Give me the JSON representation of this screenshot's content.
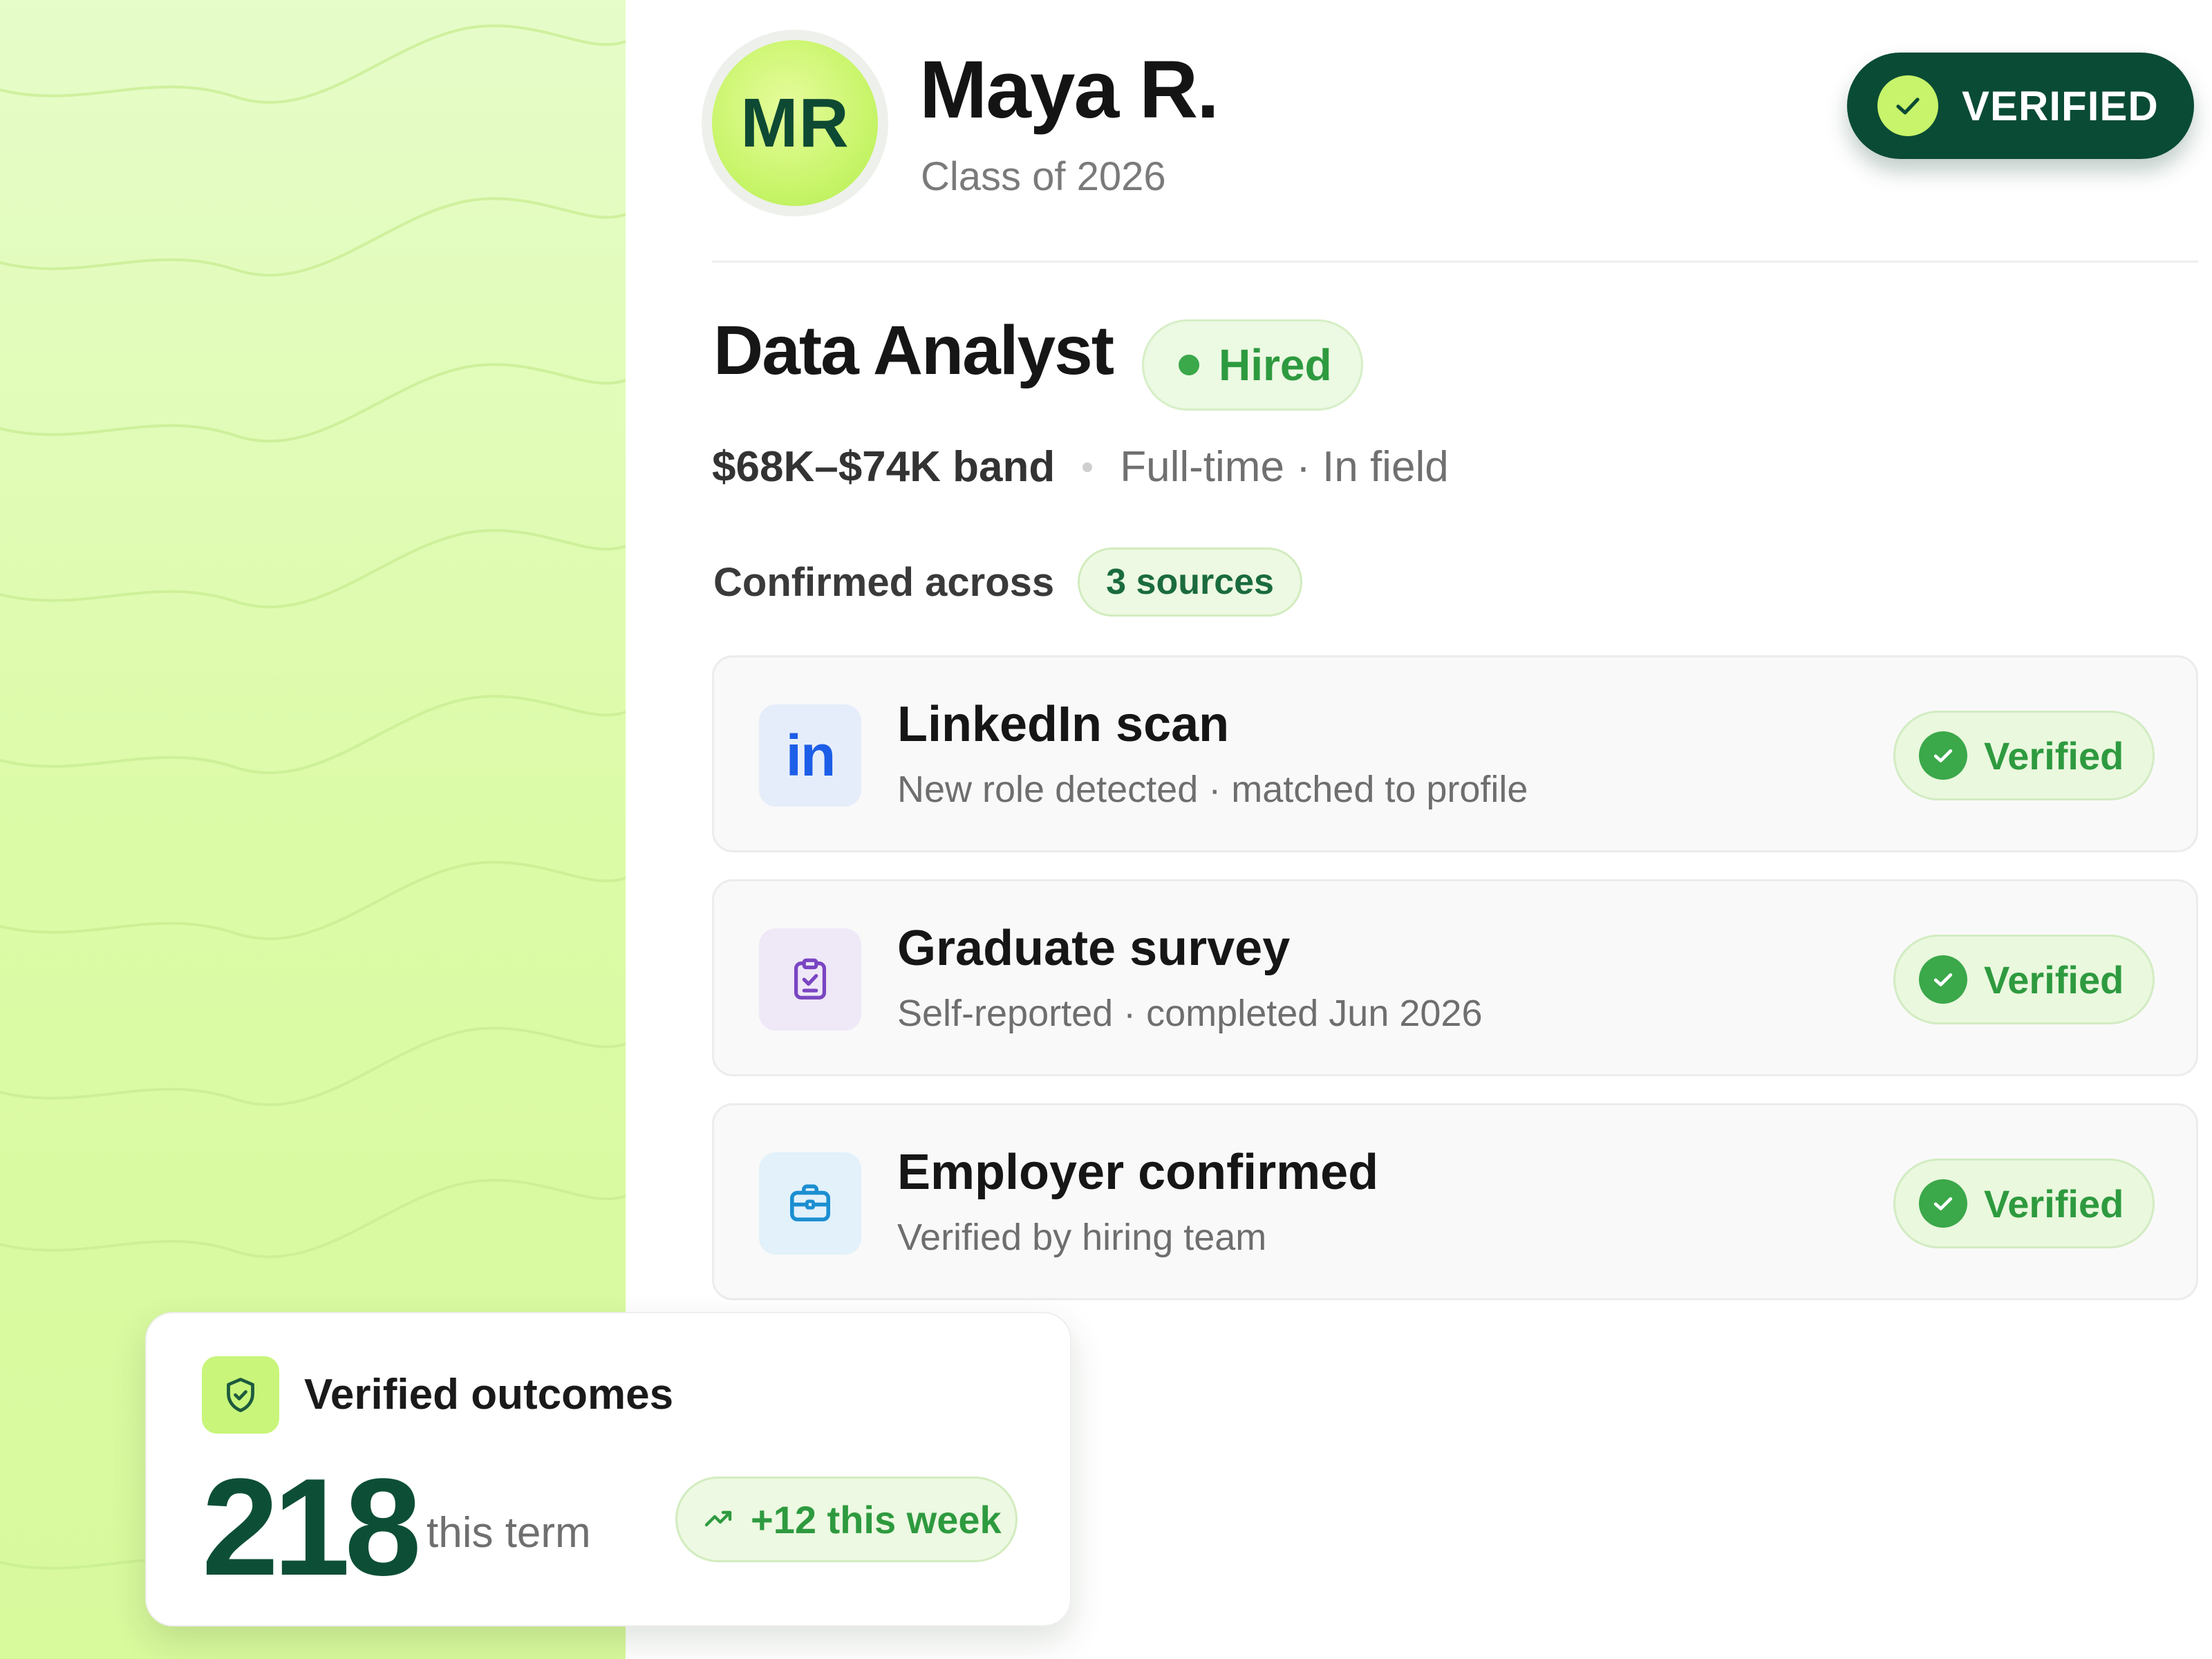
{
  "profile": {
    "initials": "MR",
    "name": "Maya R.",
    "class_of": "Class of 2026",
    "status": "VERIFIED"
  },
  "role": {
    "title": "Data Analyst",
    "status": "Hired",
    "band": "$68K–$74K band",
    "employment": "Full-time · In field"
  },
  "confirmed": {
    "label": "Confirmed across",
    "sources": "3 sources"
  },
  "sources": [
    {
      "title": "LinkedIn scan",
      "subtitle": "New role detected · matched to profile",
      "badge": "Verified",
      "icon": "linkedin-icon",
      "icon_text": "in"
    },
    {
      "title": "Graduate survey",
      "subtitle": "Self-reported · completed Jun 2026",
      "badge": "Verified",
      "icon": "clipboard-check-icon"
    },
    {
      "title": "Employer confirmed",
      "subtitle": "Verified by hiring team",
      "badge": "Verified",
      "icon": "briefcase-icon"
    }
  ],
  "outcomes": {
    "title": "Verified outcomes",
    "count": "218",
    "period": "this term",
    "delta": "+12 this week"
  },
  "colors": {
    "brand_dark": "#0a4b35",
    "accent_lime": "#c7f46a",
    "success": "#3ba84a",
    "background": "#dcfba7"
  }
}
